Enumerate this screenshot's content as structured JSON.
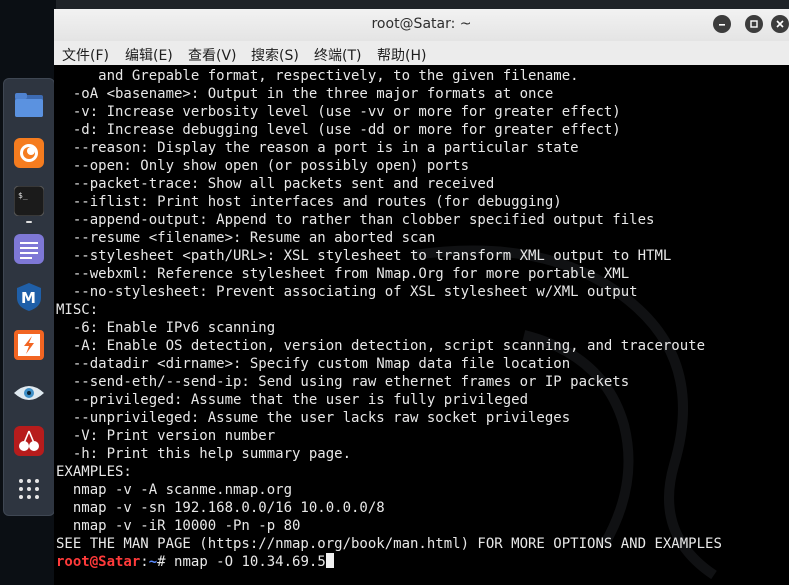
{
  "window": {
    "title": "root@Satar: ~"
  },
  "menu": [
    {
      "label": "文件(F)"
    },
    {
      "label": "编辑(E)"
    },
    {
      "label": "查看(V)"
    },
    {
      "label": "搜索(S)"
    },
    {
      "label": "终端(T)"
    },
    {
      "label": "帮助(H)"
    }
  ],
  "dock": {
    "items": [
      {
        "name": "files-icon"
      },
      {
        "name": "firefox-icon"
      },
      {
        "name": "terminal-icon"
      },
      {
        "name": "text-editor-icon"
      },
      {
        "name": "metasploit-icon"
      },
      {
        "name": "burpsuite-icon"
      },
      {
        "name": "eye-icon"
      },
      {
        "name": "cherrytree-icon"
      },
      {
        "name": "app-grid-icon"
      }
    ]
  },
  "terminal": {
    "lines": [
      "     and Grepable format, respectively, to the given filename.",
      "  -oA <basename>: Output in the three major formats at once",
      "  -v: Increase verbosity level (use -vv or more for greater effect)",
      "  -d: Increase debugging level (use -dd or more for greater effect)",
      "  --reason: Display the reason a port is in a particular state",
      "  --open: Only show open (or possibly open) ports",
      "  --packet-trace: Show all packets sent and received",
      "  --iflist: Print host interfaces and routes (for debugging)",
      "  --append-output: Append to rather than clobber specified output files",
      "  --resume <filename>: Resume an aborted scan",
      "  --stylesheet <path/URL>: XSL stylesheet to transform XML output to HTML",
      "  --webxml: Reference stylesheet from Nmap.Org for more portable XML",
      "  --no-stylesheet: Prevent associating of XSL stylesheet w/XML output",
      "MISC:",
      "  -6: Enable IPv6 scanning",
      "  -A: Enable OS detection, version detection, script scanning, and traceroute",
      "  --datadir <dirname>: Specify custom Nmap data file location",
      "  --send-eth/--send-ip: Send using raw ethernet frames or IP packets",
      "  --privileged: Assume that the user is fully privileged",
      "  --unprivileged: Assume the user lacks raw socket privileges",
      "  -V: Print version number",
      "  -h: Print this help summary page.",
      "EXAMPLES:",
      "  nmap -v -A scanme.nmap.org",
      "  nmap -v -sn 192.168.0.0/16 10.0.0.0/8",
      "  nmap -v -iR 10000 -Pn -p 80",
      "SEE THE MAN PAGE (https://nmap.org/book/man.html) FOR MORE OPTIONS AND EXAMPLES"
    ],
    "prompt": {
      "user": "root@Satar",
      "sep": ":",
      "path": "~",
      "symbol": "# ",
      "command": "nmap -O 10.34.69.5"
    }
  },
  "colors": {
    "prompt_user": "#ff3a3a",
    "prompt_path": "#5c8cff",
    "terminal_bg": "#000000",
    "terminal_fg": "#e8e8e8"
  }
}
